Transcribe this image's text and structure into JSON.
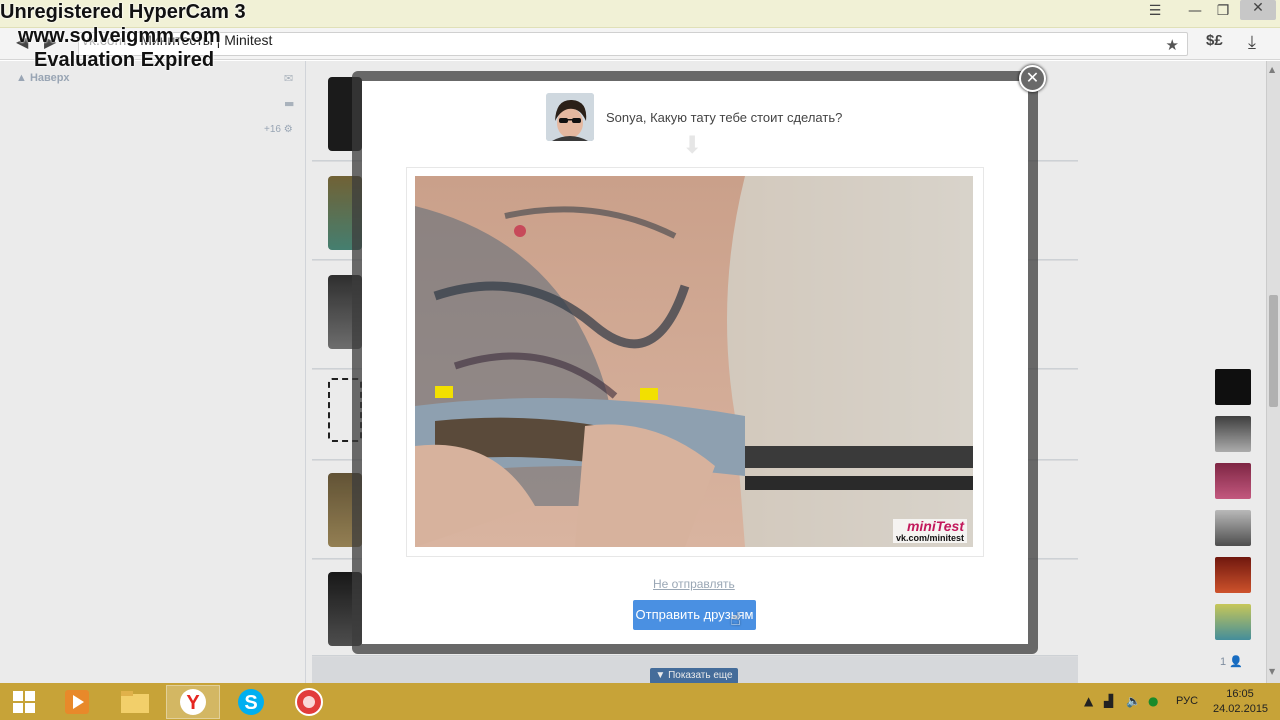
{
  "watermark": {
    "line1": "Unregistered HyperCam 3",
    "line2": "www.solveigmm.com",
    "line3": "Evaluation Expired"
  },
  "browser": {
    "url_host": "vk.com",
    "tab_title": "Минитесты | Minitest",
    "toolbar_icons": [
      "back-icon",
      "forward-icon",
      "reload-icon",
      "star-icon",
      "currency-icon",
      "download-icon",
      "menu-icon"
    ]
  },
  "left_sidebar": {
    "to_top": "Наверх",
    "count": "+16"
  },
  "modal": {
    "question": "Sonya, Какую тату тебе стоит сделать?",
    "logo_text": "miniTest",
    "logo_url": "vk.com/minitest",
    "skip_label": "Не отправлять",
    "send_label": "Отправить друзьям"
  },
  "feed": {
    "show_more": "Показать еще"
  },
  "right_sidebar": {
    "friends_count": "1"
  },
  "taskbar": {
    "apps": [
      "windows-start",
      "media-player",
      "file-explorer",
      "yandex-browser",
      "skype",
      "record-app"
    ],
    "language": "РУС",
    "time": "16:05",
    "date": "24.02.2015"
  },
  "colors": {
    "vk_blue": "#4a76a8",
    "send_button": "#4a90e2",
    "taskbar": "#c7a338"
  }
}
